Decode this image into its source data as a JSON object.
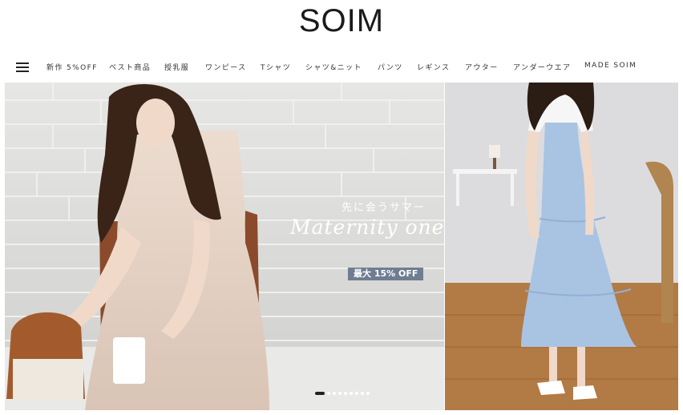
{
  "brand": {
    "logo_text": "SOIM"
  },
  "nav": {
    "menu_icon": "hamburger-menu-icon",
    "items": [
      {
        "label": "新作 5%OFF"
      },
      {
        "label": "ベスト商品"
      },
      {
        "label": "授乳服"
      },
      {
        "label": "ワンピース"
      },
      {
        "label": "Tシャツ"
      },
      {
        "label": "シャツ&ニット"
      },
      {
        "label": "パンツ"
      },
      {
        "label": "レギンス"
      },
      {
        "label": "アウター"
      },
      {
        "label": "アンダーウエア"
      },
      {
        "label": "MADE SOIM"
      }
    ]
  },
  "hero": {
    "subtitle": "先に会うサマー",
    "script_title": "Maternity onepiece",
    "badge": "最大 15% OFF",
    "slide_count": 9,
    "active_slide": 1
  },
  "colors": {
    "badge_bg": "#6f7d91",
    "text": "#222222",
    "background": "#ffffff"
  }
}
